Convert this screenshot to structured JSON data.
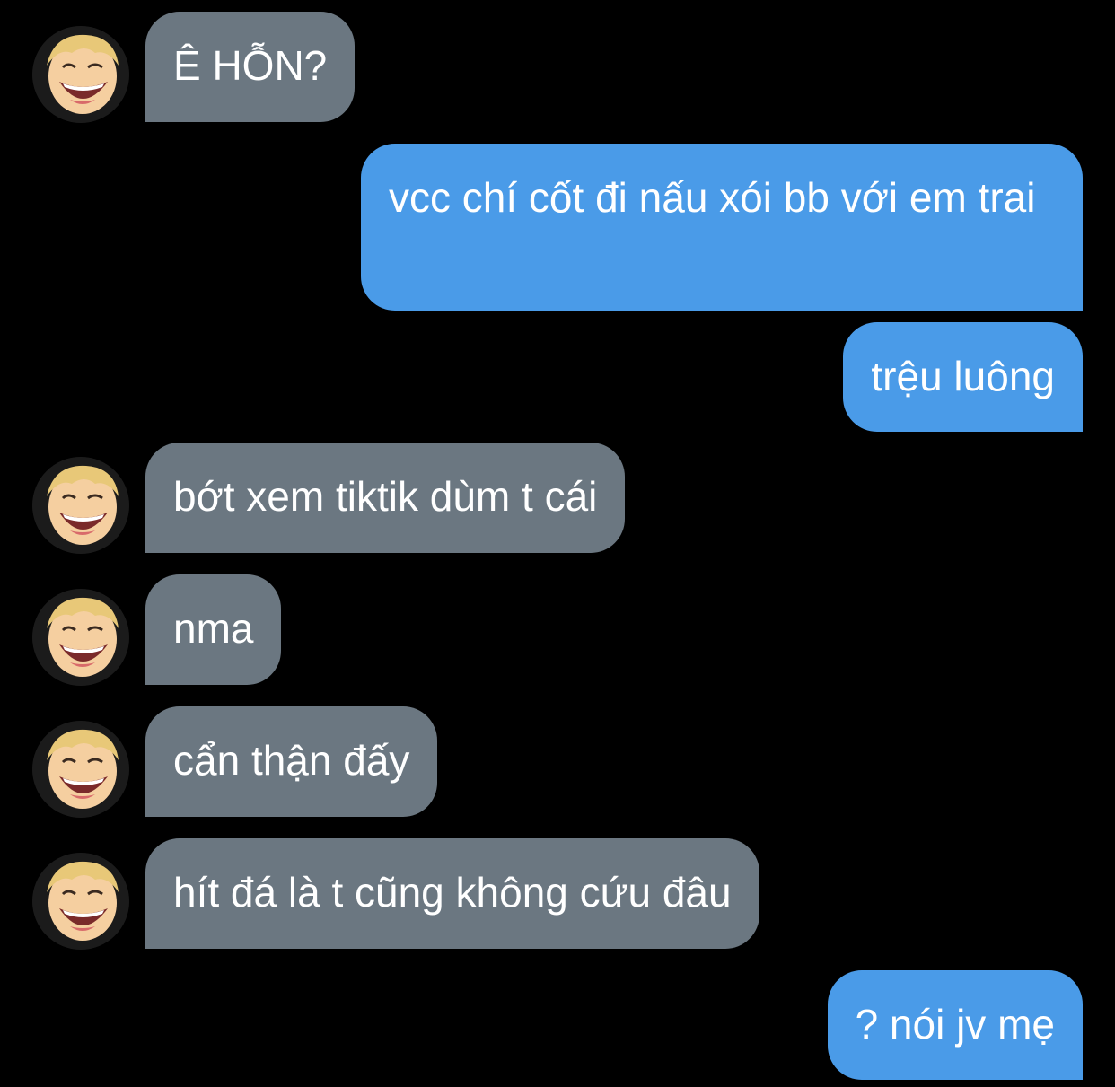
{
  "messages": [
    {
      "from": "them",
      "text": "Ê HỖN?"
    },
    {
      "from": "me",
      "text": "vcc chí cốt đi nấu xói bb với em trai"
    },
    {
      "from": "me",
      "text": "trệu luông"
    },
    {
      "from": "them",
      "text": "bớt xem tiktik dùm t cái"
    },
    {
      "from": "them",
      "text": "nma"
    },
    {
      "from": "them",
      "text": "cẩn thận đấy"
    },
    {
      "from": "them",
      "text": "hít đá là t cũng không cứu đâu"
    },
    {
      "from": "me",
      "text": "? nói jv mẹ"
    }
  ],
  "colors": {
    "background": "#000000",
    "incoming_bubble": "#6b7781",
    "outgoing_bubble": "#4a9be8",
    "text": "#ffffff"
  },
  "icons": {
    "avatar": "avatar-icon"
  }
}
